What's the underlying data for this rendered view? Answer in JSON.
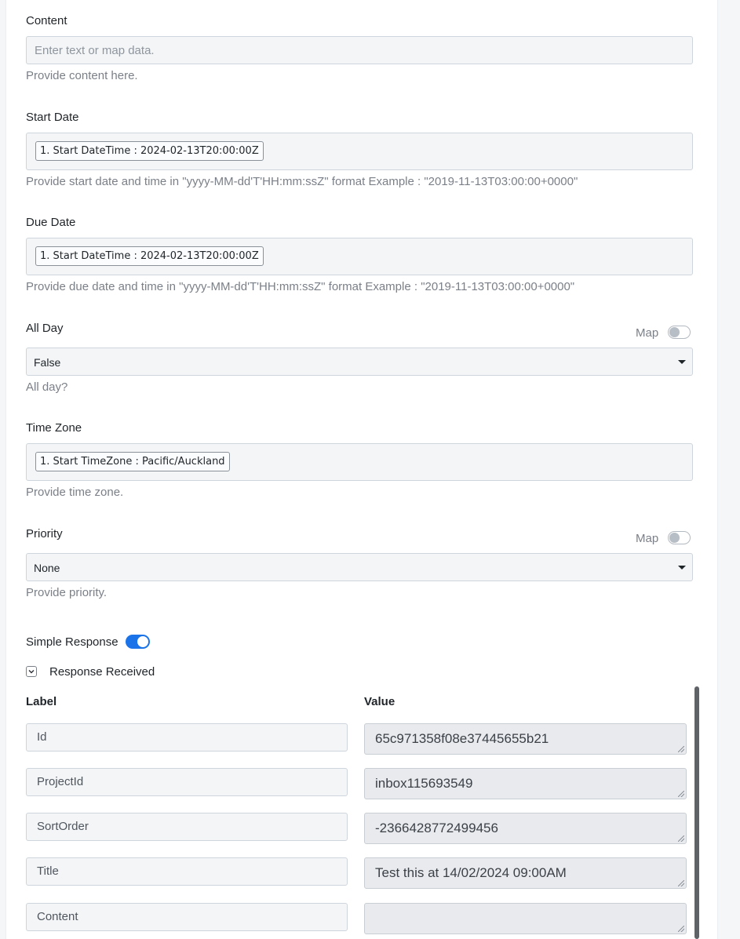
{
  "fields": {
    "content": {
      "label": "Content",
      "placeholder": "Enter text or map data.",
      "help": "Provide content here."
    },
    "start_date": {
      "label": "Start Date",
      "chip": "1. Start DateTime : 2024-02-13T20:00:00Z",
      "help": "Provide start date and time in \"yyyy-MM-dd'T'HH:mm:ssZ\" format Example : \"2019-11-13T03:00:00+0000\""
    },
    "due_date": {
      "label": "Due Date",
      "chip": "1. Start DateTime : 2024-02-13T20:00:00Z",
      "help": "Provide due date and time in \"yyyy-MM-dd'T'HH:mm:ssZ\" format Example : \"2019-11-13T03:00:00+0000\""
    },
    "all_day": {
      "label": "All Day",
      "map_label": "Map",
      "value": "False",
      "help": "All day?"
    },
    "time_zone": {
      "label": "Time Zone",
      "chip": "1. Start TimeZone : Pacific/Auckland",
      "help": "Provide time zone."
    },
    "priority": {
      "label": "Priority",
      "map_label": "Map",
      "value": "None",
      "help": "Provide priority."
    }
  },
  "simple_response": {
    "label": "Simple Response",
    "enabled": true
  },
  "response": {
    "title": "Response Received",
    "columns": {
      "label": "Label",
      "value": "Value"
    },
    "rows": [
      {
        "label": "Id",
        "value": "65c971358f08e37445655b21"
      },
      {
        "label": "ProjectId",
        "value": "inbox115693549"
      },
      {
        "label": "SortOrder",
        "value": "-2366428772499456"
      },
      {
        "label": "Title",
        "value": "Test this at  14/02/2024 09:00AM"
      },
      {
        "label": "Content",
        "value": ""
      }
    ]
  },
  "colors": {
    "accent": "#1a73e8"
  }
}
